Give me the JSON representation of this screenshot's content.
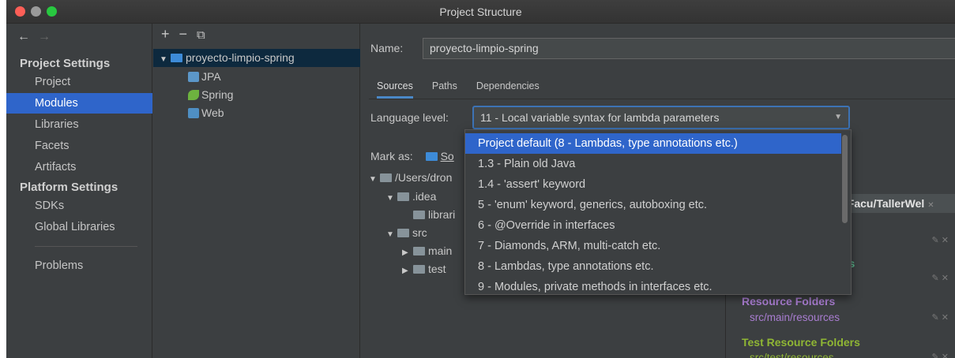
{
  "window": {
    "title": "Project Structure"
  },
  "sidebar": {
    "project_settings_heading": "Project Settings",
    "platform_settings_heading": "Platform Settings",
    "project_items": [
      "Project",
      "Modules",
      "Libraries",
      "Facets",
      "Artifacts"
    ],
    "platform_items": [
      "SDKs",
      "Global Libraries"
    ],
    "problems": "Problems",
    "selected": "Modules"
  },
  "module_tree": {
    "toolbar": {
      "add": "+",
      "remove": "−",
      "copy": "⧉"
    },
    "root": "proyecto-limpio-spring",
    "children": [
      "JPA",
      "Spring",
      "Web"
    ]
  },
  "main": {
    "name_label": "Name:",
    "name_value": "proyecto-limpio-spring",
    "tabs": [
      "Sources",
      "Paths",
      "Dependencies"
    ],
    "active_tab": "Sources",
    "language_level_label": "Language level:",
    "language_level_value": "11 - Local variable syntax for lambda parameters",
    "mark_as_label": "Mark as:",
    "mark_as_sources": "So"
  },
  "content_tree": [
    {
      "label": "/Users/dron",
      "expanded": true
    },
    {
      "label": ".idea",
      "expanded": true
    },
    {
      "label": "librari",
      "expanded": false
    },
    {
      "label": "src",
      "expanded": true
    },
    {
      "label": "main",
      "expanded": false
    },
    {
      "label": "test",
      "expanded": false
    }
  ],
  "right_panel": {
    "header_fragment": "t",
    "path": "./Facu/TallerWel",
    "rs_fragment": "rs",
    "resource_folders_heading": "Resource Folders",
    "resource_folders_path": "src/main/resources",
    "test_resource_folders_heading": "Test Resource Folders",
    "test_resource_folders_path": "src/test/resources"
  },
  "dropdown": {
    "options": [
      "Project default (8 - Lambdas, type annotations etc.)",
      "1.3 - Plain old Java",
      "1.4 - 'assert' keyword",
      "5 - 'enum' keyword, generics, autoboxing etc.",
      "6 - @Override in interfaces",
      "7 - Diamonds, ARM, multi-catch etc.",
      "8 - Lambdas, type annotations etc.",
      "9 - Modules, private methods in interfaces etc."
    ],
    "highlighted_index": 0
  },
  "colors": {
    "selection": "#2f65ca",
    "panel_bg": "#3c3f41",
    "focus_border": "#3d73b5",
    "resource_purple": "#a97dd1",
    "test_green": "#8fb634"
  }
}
